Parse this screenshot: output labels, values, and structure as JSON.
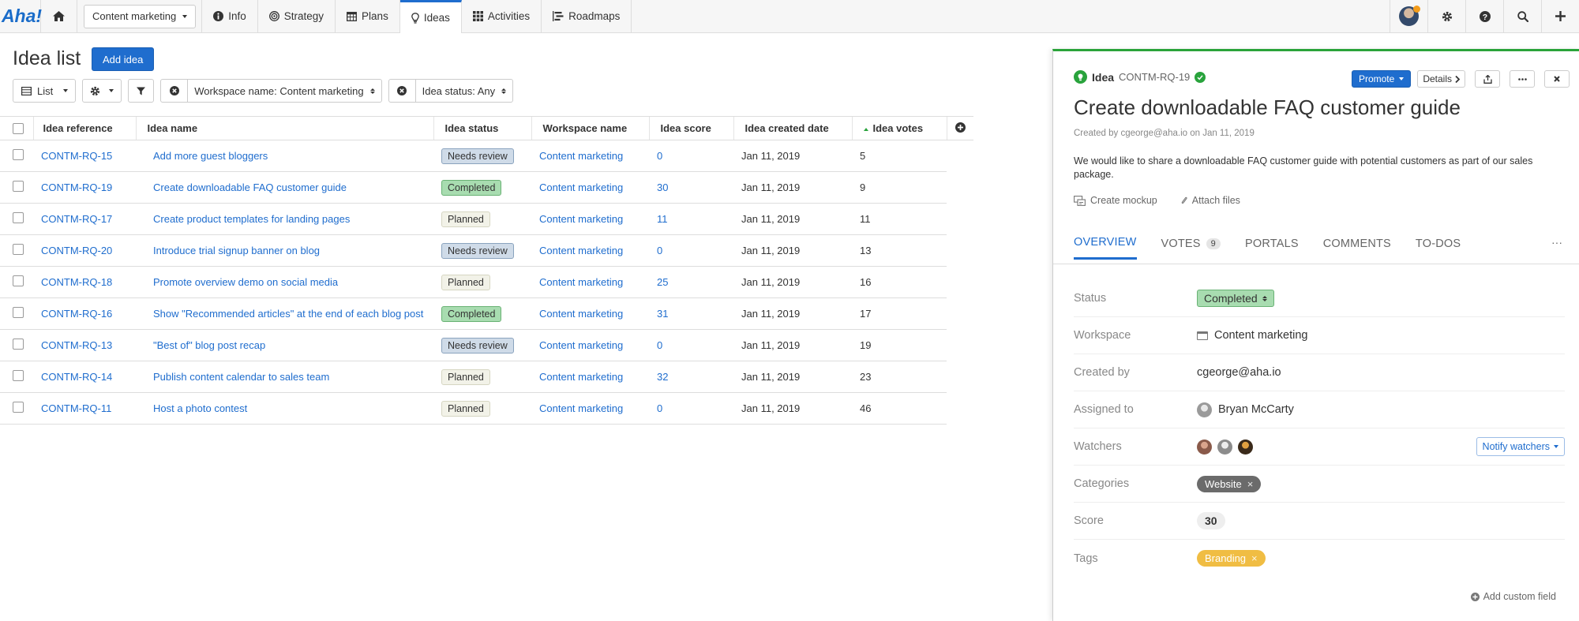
{
  "nav": {
    "logo": "Aha!",
    "workspace_select": "Content marketing",
    "tabs": [
      {
        "label": "Info",
        "icon": "info-icon"
      },
      {
        "label": "Strategy",
        "icon": "target-icon"
      },
      {
        "label": "Plans",
        "icon": "calendar-icon"
      },
      {
        "label": "Ideas",
        "icon": "lightbulb-icon",
        "active": true
      },
      {
        "label": "Activities",
        "icon": "grid-icon"
      },
      {
        "label": "Roadmaps",
        "icon": "roadmap-icon"
      }
    ],
    "right_icons": [
      "avatar",
      "gear-icon",
      "help-icon",
      "search-icon",
      "plus-icon"
    ]
  },
  "list": {
    "title": "Idea list",
    "add_button": "Add idea",
    "view_button": "List",
    "filters": {
      "workspace": "Workspace name: Content marketing",
      "status": "Idea status: Any"
    },
    "columns": [
      "Idea reference",
      "Idea name",
      "Idea status",
      "Workspace name",
      "Idea score",
      "Idea created date",
      "Idea votes"
    ],
    "rows": [
      {
        "ref": "CONTM-RQ-15",
        "name": "Add more guest bloggers",
        "status": "Needs review",
        "status_kind": "needs",
        "workspace": "Content marketing",
        "score": "0",
        "date": "Jan 11, 2019",
        "votes": "5"
      },
      {
        "ref": "CONTM-RQ-19",
        "name": "Create downloadable FAQ customer guide",
        "status": "Completed",
        "status_kind": "completed",
        "workspace": "Content marketing",
        "score": "30",
        "date": "Jan 11, 2019",
        "votes": "9"
      },
      {
        "ref": "CONTM-RQ-17",
        "name": "Create product templates for landing pages",
        "status": "Planned",
        "status_kind": "planned",
        "workspace": "Content marketing",
        "score": "11",
        "date": "Jan 11, 2019",
        "votes": "11"
      },
      {
        "ref": "CONTM-RQ-20",
        "name": "Introduce trial signup banner on blog",
        "status": "Needs review",
        "status_kind": "needs",
        "workspace": "Content marketing",
        "score": "0",
        "date": "Jan 11, 2019",
        "votes": "13"
      },
      {
        "ref": "CONTM-RQ-18",
        "name": "Promote overview demo on social media",
        "status": "Planned",
        "status_kind": "planned",
        "workspace": "Content marketing",
        "score": "25",
        "date": "Jan 11, 2019",
        "votes": "16"
      },
      {
        "ref": "CONTM-RQ-16",
        "name": "Show \"Recommended articles\" at the end of each blog post",
        "status": "Completed",
        "status_kind": "completed",
        "workspace": "Content marketing",
        "score": "31",
        "date": "Jan 11, 2019",
        "votes": "17"
      },
      {
        "ref": "CONTM-RQ-13",
        "name": "\"Best of\" blog post recap",
        "status": "Needs review",
        "status_kind": "needs",
        "workspace": "Content marketing",
        "score": "0",
        "date": "Jan 11, 2019",
        "votes": "19"
      },
      {
        "ref": "CONTM-RQ-14",
        "name": "Publish content calendar to sales team",
        "status": "Planned",
        "status_kind": "planned",
        "workspace": "Content marketing",
        "score": "32",
        "date": "Jan 11, 2019",
        "votes": "23"
      },
      {
        "ref": "CONTM-RQ-11",
        "name": "Host a photo contest",
        "status": "Planned",
        "status_kind": "planned",
        "workspace": "Content marketing",
        "score": "0",
        "date": "Jan 11, 2019",
        "votes": "46"
      }
    ]
  },
  "detail": {
    "type": "Idea",
    "ref": "CONTM-RQ-19",
    "promote_label": "Promote",
    "details_label": "Details",
    "title": "Create downloadable FAQ customer guide",
    "created_line": "Created by cgeorge@aha.io on Jan 11, 2019",
    "description": "We would like to share a downloadable FAQ customer guide with potential customers as part of our sales package.",
    "create_mockup": "Create mockup",
    "attach_files": "Attach files",
    "tabs": {
      "overview": "OVERVIEW",
      "votes": "VOTES",
      "votes_count": "9",
      "portals": "PORTALS",
      "comments": "COMMENTS",
      "todos": "TO-DOS",
      "more": "···"
    },
    "fields": {
      "status_label": "Status",
      "status_value": "Completed",
      "workspace_label": "Workspace",
      "workspace_value": "Content marketing",
      "created_by_label": "Created by",
      "created_by_value": "cgeorge@aha.io",
      "assigned_label": "Assigned to",
      "assigned_value": "Bryan McCarty",
      "watchers_label": "Watchers",
      "notify_label": "Notify watchers",
      "categories_label": "Categories",
      "category_value": "Website",
      "score_label": "Score",
      "score_value": "30",
      "tags_label": "Tags",
      "tag_value": "Branding"
    },
    "add_custom_field": "Add custom field"
  },
  "colors": {
    "accent": "#1f6dce",
    "green": "#29a33c",
    "tag_branding": "#f0bd43"
  }
}
